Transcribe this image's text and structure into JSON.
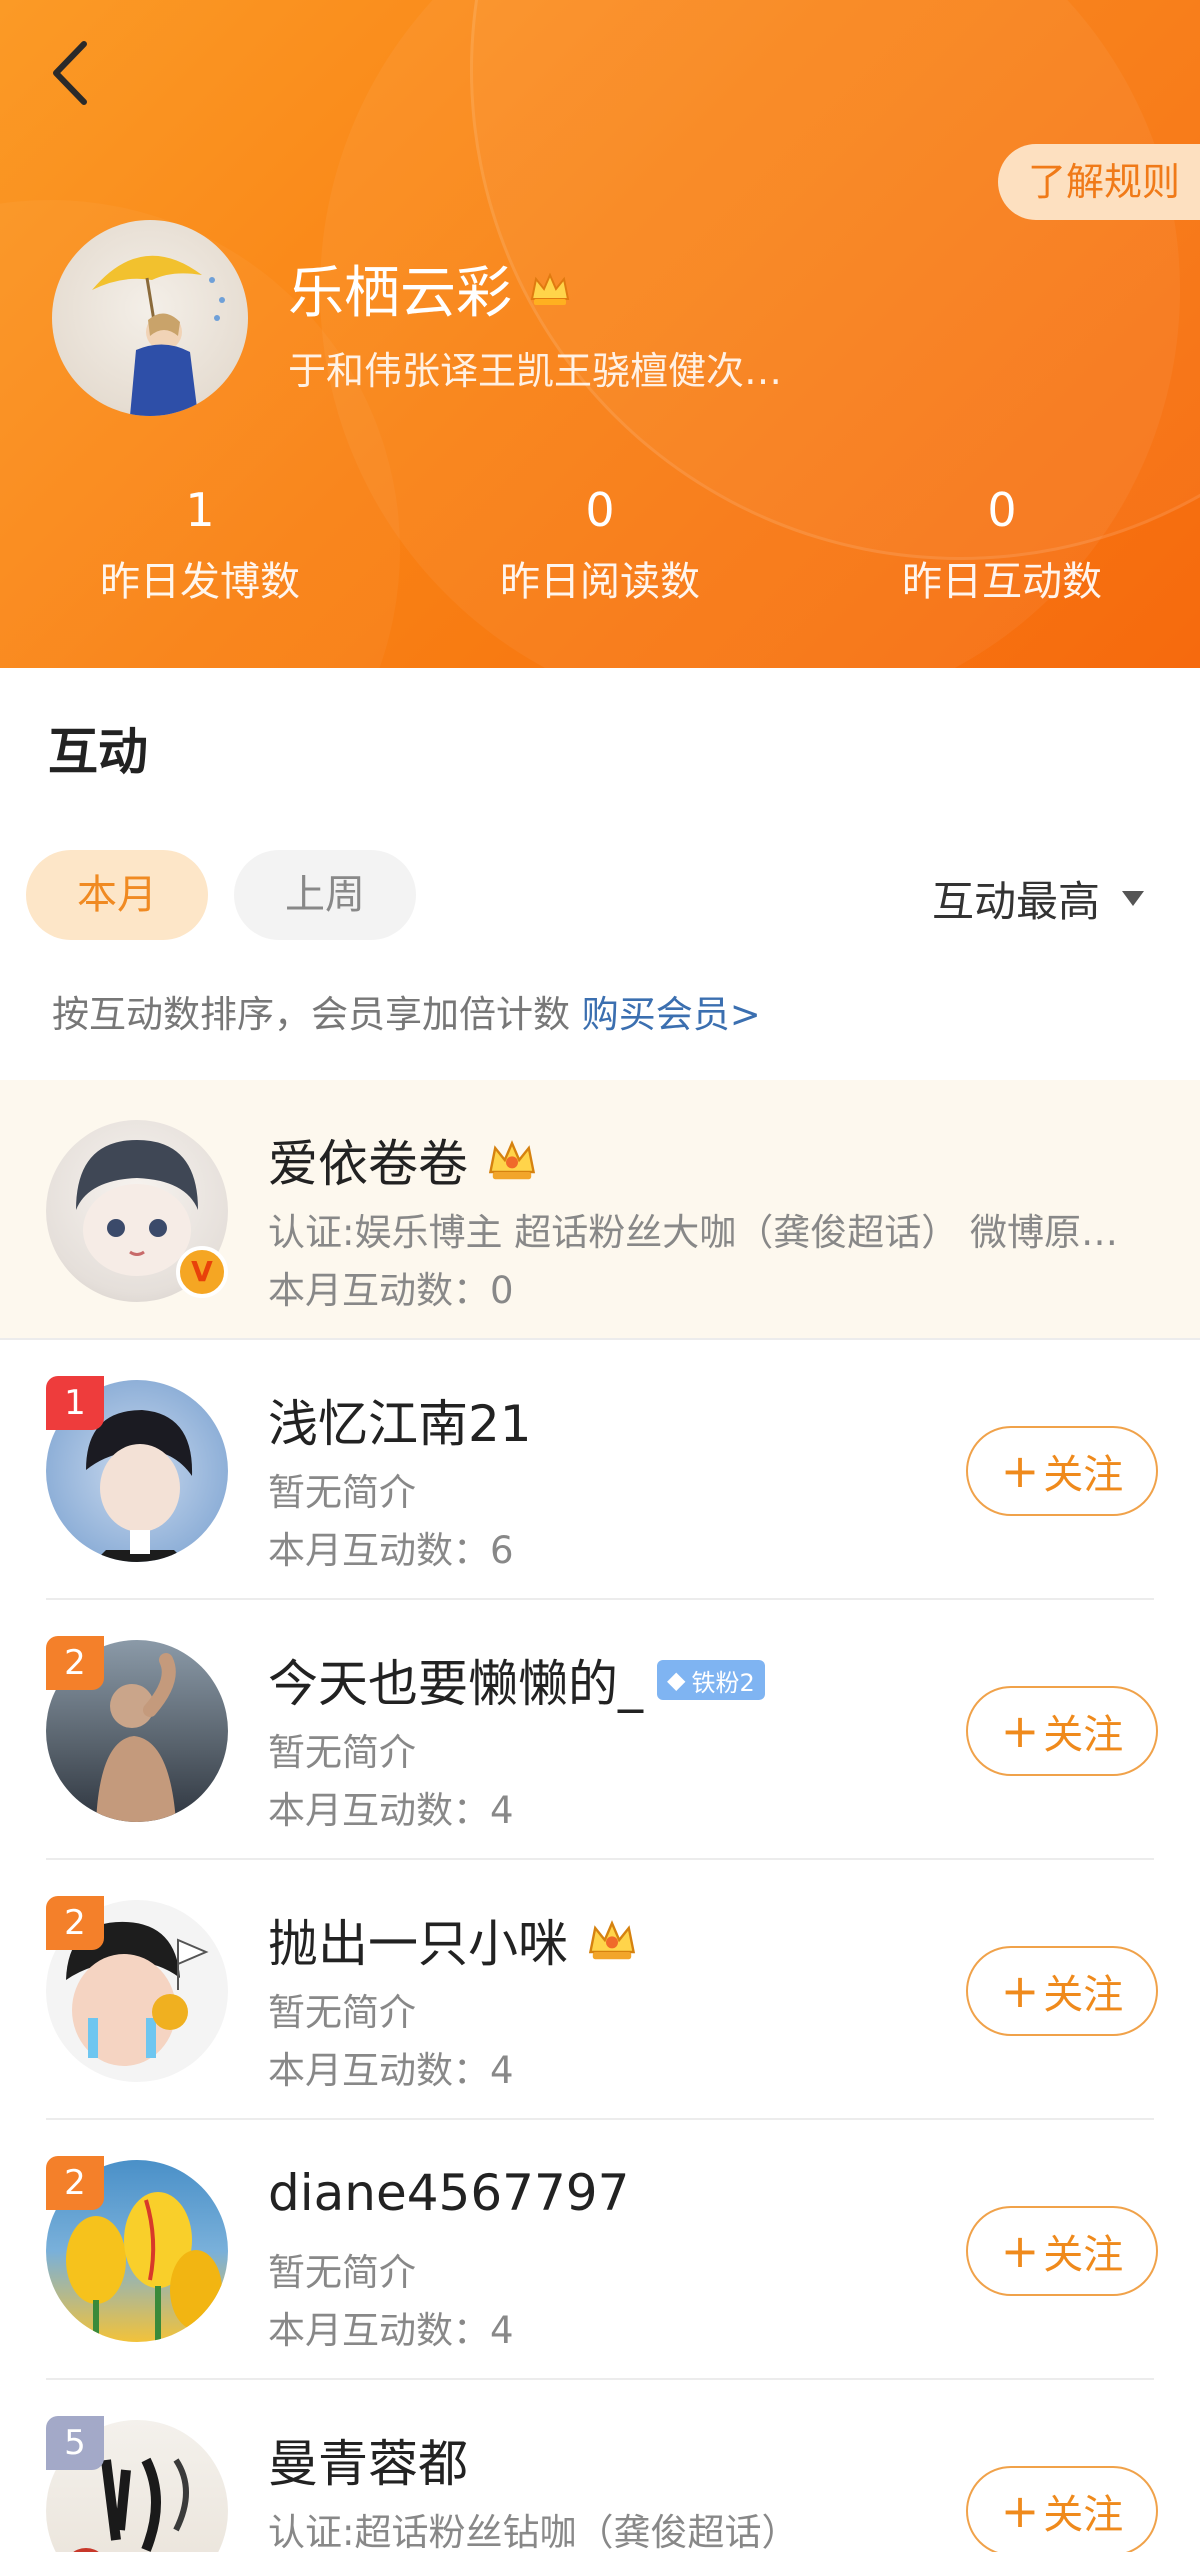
{
  "header": {
    "rules_button": "了解规则",
    "username": "乐栖云彩",
    "bio": "于和伟张译王凯王骁檀健次…",
    "stats": [
      {
        "value": "1",
        "label": "昨日发博数"
      },
      {
        "value": "0",
        "label": "昨日阅读数"
      },
      {
        "value": "0",
        "label": "昨日互动数"
      }
    ]
  },
  "section": {
    "title": "互动",
    "tabs": [
      "本月",
      "上周"
    ],
    "sort_label": "互动最高",
    "hint_text": "按互动数排序，会员享加倍计数 ",
    "hint_link": "购买会员>"
  },
  "rows": [
    {
      "name": "爱依卷卷",
      "desc": "认证:娱乐博主 超话粉丝大咖（龚俊超话） 微博原…",
      "count": "本月互动数：0",
      "rank": "",
      "badge": "crown",
      "verified": "V"
    },
    {
      "name": "浅忆江南21",
      "desc": "暂无简介",
      "count": "本月互动数：6",
      "rank": "1",
      "follow": "关注"
    },
    {
      "name": "今天也要懒懒的_",
      "desc": "暂无简介",
      "count": "本月互动数：4",
      "rank": "2",
      "fan_badge": "铁粉2",
      "follow": "关注"
    },
    {
      "name": "抛出一只小咪",
      "desc": "暂无简介",
      "count": "本月互动数：4",
      "rank": "2",
      "badge": "crown",
      "follow": "关注"
    },
    {
      "name": "diane4567797",
      "desc": "暂无简介",
      "count": "本月互动数：4",
      "rank": "2",
      "follow": "关注"
    },
    {
      "name": "曼青蓉都",
      "desc": "认证:超话粉丝钻咖（龚俊超话）",
      "count": "",
      "rank": "5",
      "follow": "关注"
    }
  ],
  "colors": {
    "header_orange": "#f98214",
    "accent": "#ef8a1c",
    "link_blue": "#3b6fb0"
  }
}
